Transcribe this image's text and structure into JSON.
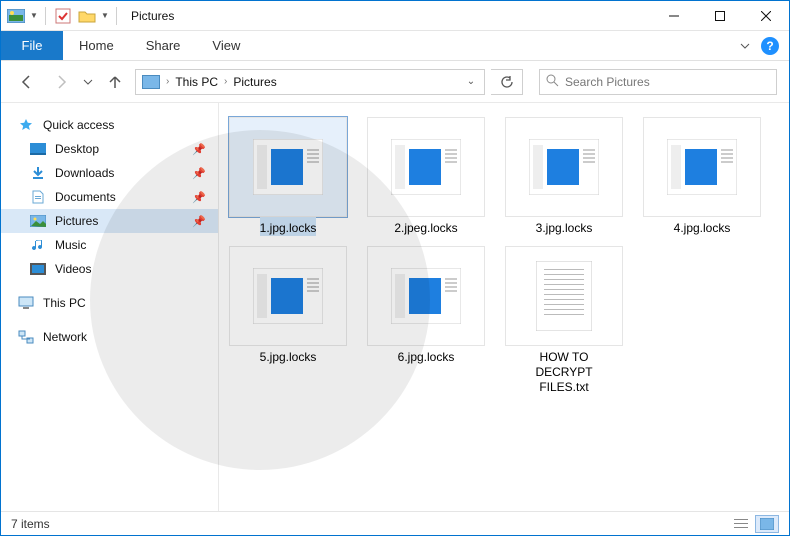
{
  "title": "Pictures",
  "ribbon": {
    "file": "File",
    "tabs": [
      "Home",
      "Share",
      "View"
    ]
  },
  "breadcrumb": {
    "parts": [
      "This PC",
      "Pictures"
    ]
  },
  "search": {
    "placeholder": "Search Pictures"
  },
  "nav": {
    "quick_access": "Quick access",
    "items": [
      {
        "label": "Desktop",
        "pinned": true,
        "icon": "desktop"
      },
      {
        "label": "Downloads",
        "pinned": true,
        "icon": "downloads"
      },
      {
        "label": "Documents",
        "pinned": true,
        "icon": "documents"
      },
      {
        "label": "Pictures",
        "pinned": true,
        "icon": "pictures",
        "selected": true
      },
      {
        "label": "Music",
        "pinned": false,
        "icon": "music"
      },
      {
        "label": "Videos",
        "pinned": false,
        "icon": "videos"
      }
    ],
    "this_pc": "This PC",
    "network": "Network"
  },
  "files": [
    {
      "name": "1.jpg.locks",
      "type": "generic",
      "selected": true
    },
    {
      "name": "2.jpeg.locks",
      "type": "generic"
    },
    {
      "name": "3.jpg.locks",
      "type": "generic"
    },
    {
      "name": "4.jpg.locks",
      "type": "generic"
    },
    {
      "name": "5.jpg.locks",
      "type": "generic"
    },
    {
      "name": "6.jpg.locks",
      "type": "generic"
    },
    {
      "name": "HOW TO\nDECRYPT\nFILES.txt",
      "type": "text"
    }
  ],
  "status": {
    "count": "7 items"
  }
}
